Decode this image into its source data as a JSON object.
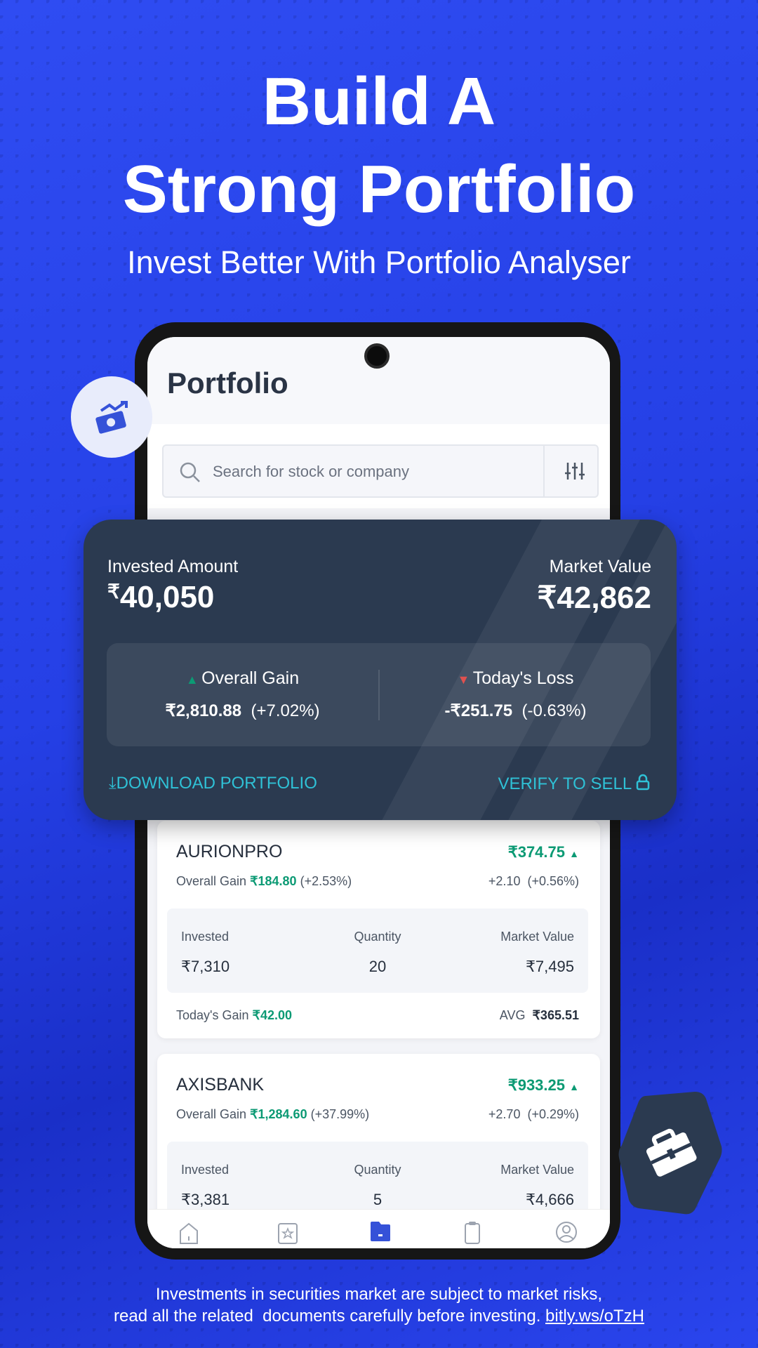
{
  "hero": {
    "line1": "Build A",
    "line2": "Strong Portfolio",
    "subtitle": "Invest Better With Portfolio Analyser"
  },
  "app": {
    "title": "Portfolio",
    "search_placeholder": "Search for stock or company"
  },
  "summary": {
    "invested_label": "Invested Amount",
    "invested_value": "40,050",
    "currency": "₹",
    "market_label": "Market Value",
    "market_value": "42,862",
    "overall_gain_label": "Overall Gain",
    "overall_gain_value": "₹2,810.88",
    "overall_gain_pct": "(+7.02%)",
    "todays_loss_label": "Today's Loss",
    "todays_loss_value": "-₹251.75",
    "todays_loss_pct": "(-0.63%)",
    "download_label": "DOWNLOAD PORTFOLIO",
    "verify_label": "VERIFY TO SELL",
    "gain_color": "#0c9a74",
    "loss_color": "#e0514f",
    "accent": "#2fc1d6"
  },
  "holdings": [
    {
      "name": "AURIONPRO",
      "price": "₹374.75",
      "gain_label": "Overall Gain",
      "gain_value": "₹184.80",
      "gain_pct": "(+2.53%)",
      "day_change": "+2.10  (+0.56%)",
      "invested_label": "Invested",
      "invested": "₹7,310",
      "qty_label": "Quantity",
      "qty": "20",
      "mv_label": "Market Value",
      "mv": "₹7,495",
      "today_label": "Today's Gain",
      "today_value": "₹42.00",
      "avg_label": "AVG",
      "avg": "₹365.51"
    },
    {
      "name": "AXISBANK",
      "price": "₹933.25",
      "gain_label": "Overall Gain",
      "gain_value": "₹1,284.60",
      "gain_pct": "(+37.99%)",
      "day_change": "+2.70  (+0.29%)",
      "invested_label": "Invested",
      "invested": "₹3,381",
      "qty_label": "Quantity",
      "qty": "5",
      "mv_label": "Market Value",
      "mv": "₹4,666"
    }
  ],
  "nav": [
    "home-icon",
    "watchlist-icon",
    "portfolio-icon",
    "orders-icon",
    "profile-icon"
  ],
  "disclaimer": {
    "line1": "Investments in securities market are subject to market risks,",
    "line2": "read all the related  documents carefully before investing.",
    "link": "bitly.ws/oTzH"
  }
}
